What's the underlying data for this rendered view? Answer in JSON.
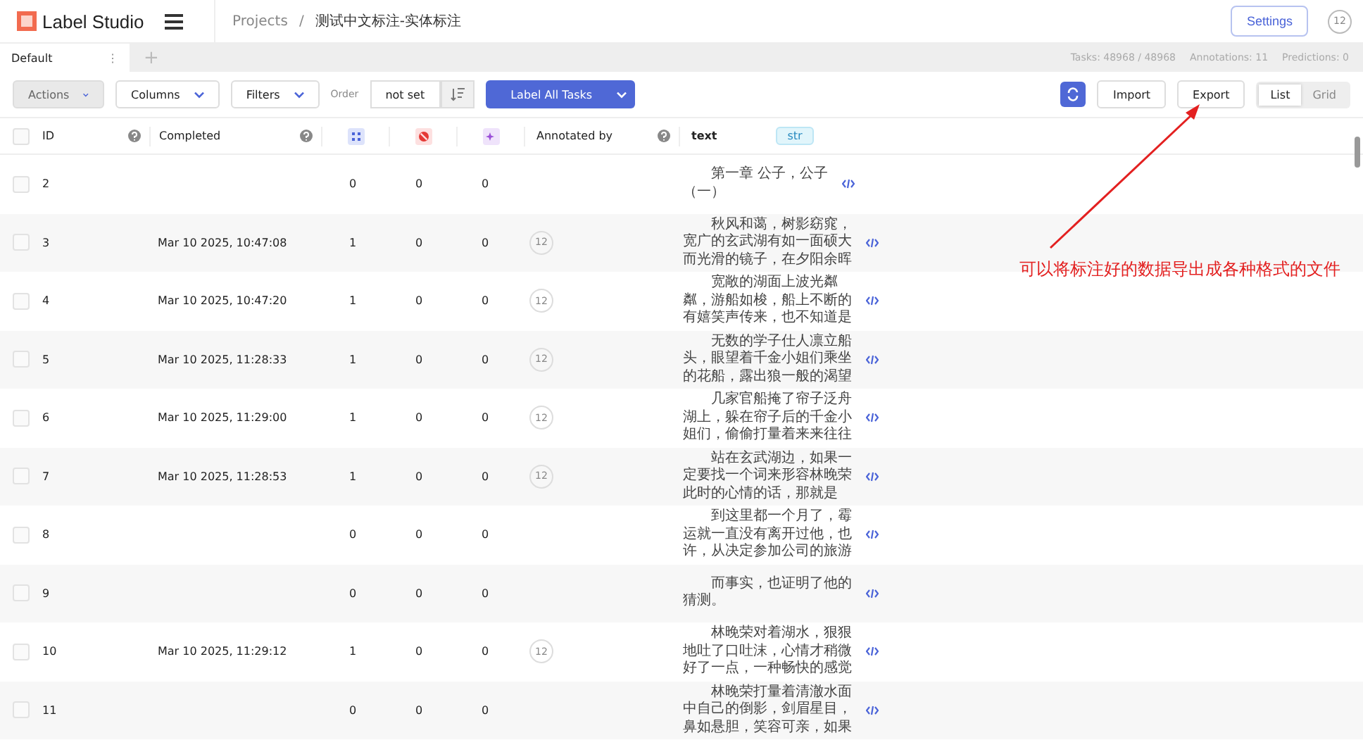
{
  "header": {
    "logo": "Label Studio",
    "breadcrumb": {
      "root": "Projects",
      "separator": "/",
      "project": "测试中文标注-实体标注"
    },
    "settings": "Settings",
    "avatar": "12"
  },
  "tabs": [
    {
      "label": "Default",
      "selected": true,
      "menu": "⋮"
    }
  ],
  "add_tab": "+",
  "stats": {
    "tasks": "Tasks: 48968 / 48968",
    "annotations": "Annotations: 11",
    "predictions": "Predictions: 0"
  },
  "toolbar": {
    "actions": "Actions",
    "columns": "Columns",
    "filters": "Filters",
    "order_label": "Order",
    "order_value": "not set",
    "label_all": "Label All Tasks",
    "import": "Import",
    "export": "Export",
    "views": [
      {
        "label": "List",
        "selected": true
      },
      {
        "label": "Grid",
        "selected": false
      }
    ]
  },
  "table": {
    "select_all_checked": false,
    "columns": {
      "id": "ID",
      "completed": "Completed",
      "annotated_by": "Annotated by",
      "text": "text",
      "text_type": "str"
    },
    "rows": [
      {
        "id": "2",
        "completed": "",
        "total": "0",
        "cancelled": "0",
        "predictions": "0",
        "annotator": "",
        "text": [
          "第一章 公子，公子",
          "（一）"
        ],
        "checked": false
      },
      {
        "id": "3",
        "completed": "Mar 10 2025, 10:47:08",
        "total": "1",
        "cancelled": "0",
        "predictions": "0",
        "annotator": "12",
        "text": [
          "秋风和蔼，树影窈窕，",
          "宽广的玄武湖有如一面硕大",
          "而光滑的镜子，在夕阳余晖"
        ],
        "checked": false
      },
      {
        "id": "4",
        "completed": "Mar 10 2025, 10:47:20",
        "total": "1",
        "cancelled": "0",
        "predictions": "0",
        "annotator": "12",
        "text": [
          "宽敞的湖面上波光粼",
          "粼，游船如梭，船上不断的",
          "有嬉笑声传来，也不知道是"
        ],
        "checked": false
      },
      {
        "id": "5",
        "completed": "Mar 10 2025, 11:28:33",
        "total": "1",
        "cancelled": "0",
        "predictions": "0",
        "annotator": "12",
        "text": [
          "无数的学子仕人凛立船",
          "头，眼望着千金小姐们乘坐",
          "的花船，露出狼一般的渴望"
        ],
        "checked": false
      },
      {
        "id": "6",
        "completed": "Mar 10 2025, 11:29:00",
        "total": "1",
        "cancelled": "0",
        "predictions": "0",
        "annotator": "12",
        "text": [
          "几家官船掩了帘子泛舟",
          "湖上，躲在帘子后的千金小",
          "姐们，偷偷打量着来来往往"
        ],
        "checked": false
      },
      {
        "id": "7",
        "completed": "Mar 10 2025, 11:28:53",
        "total": "1",
        "cancelled": "0",
        "predictions": "0",
        "annotator": "12",
        "text": [
          "站在玄武湖边，如果一",
          "定要找一个词来形容林晚荣",
          "此时的心情的话，那就是"
        ],
        "checked": false
      },
      {
        "id": "8",
        "completed": "",
        "total": "0",
        "cancelled": "0",
        "predictions": "0",
        "annotator": "",
        "text": [
          "到这里都一个月了，霉",
          "运就一直没有离开过他，也",
          "许，从决定参加公司的旅游"
        ],
        "checked": false
      },
      {
        "id": "9",
        "completed": "",
        "total": "0",
        "cancelled": "0",
        "predictions": "0",
        "annotator": "",
        "text": [
          "而事实，也证明了他的",
          "猜测。"
        ],
        "checked": false
      },
      {
        "id": "10",
        "completed": "Mar 10 2025, 11:29:12",
        "total": "1",
        "cancelled": "0",
        "predictions": "0",
        "annotator": "12",
        "text": [
          "林晚荣对着湖水，狠狠",
          "地吐了口吐沫，心情才稍微",
          "好了一点，一种畅快的感觉"
        ],
        "checked": false
      },
      {
        "id": "11",
        "completed": "",
        "total": "0",
        "cancelled": "0",
        "predictions": "0",
        "annotator": "",
        "text": [
          "林晚荣打量着清澈水面",
          "中自己的倒影，剑眉星目，",
          "鼻如悬胆，笑容可亲，如果"
        ],
        "checked": false
      }
    ]
  },
  "annotation_note": "可以将标注好的数据导出成各种格式的文件"
}
